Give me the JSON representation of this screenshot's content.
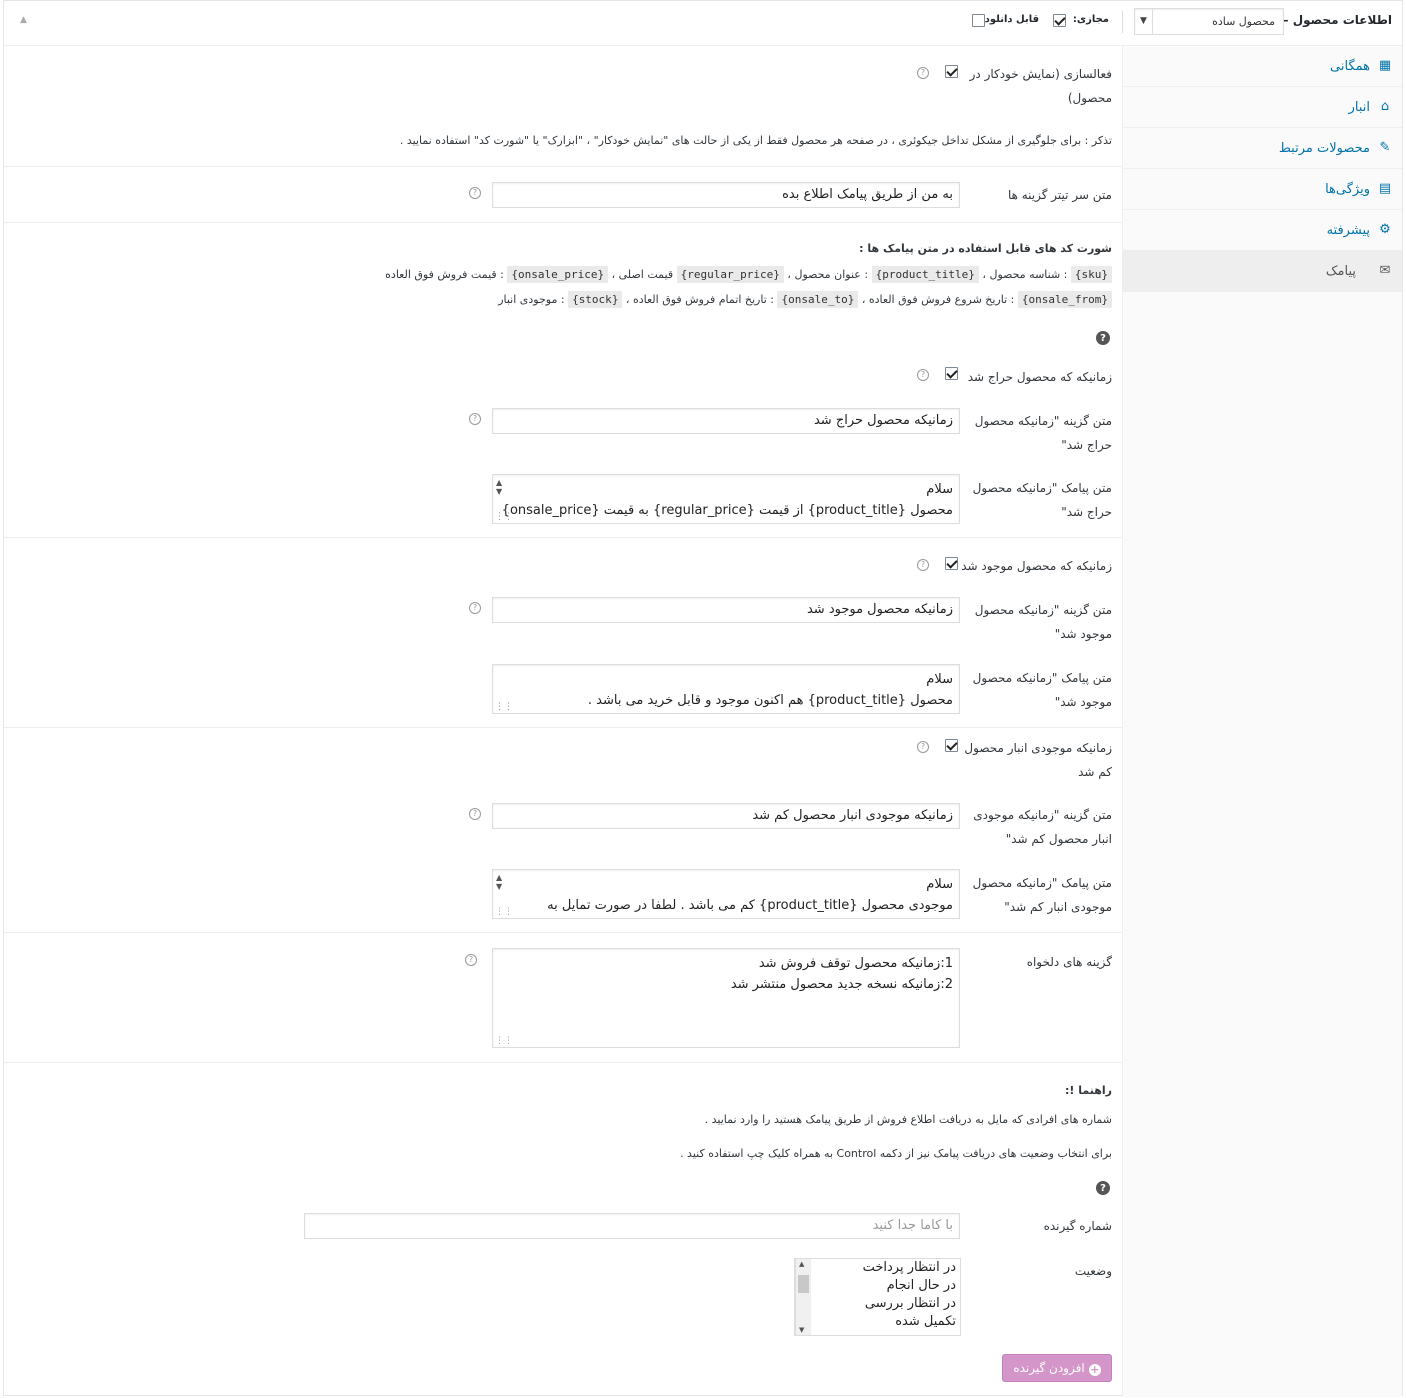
{
  "header": {
    "title": "اطلاعات محصول —",
    "product_type": "محصول ساده",
    "virtual_label": "مجازی:",
    "downloadable_label": "قابل دانلود:",
    "virtual_checked": true,
    "downloadable_checked": false
  },
  "tabs": [
    {
      "label": "همگانی",
      "icon": "general-icon"
    },
    {
      "label": "انبار",
      "icon": "inventory-icon"
    },
    {
      "label": "محصولات مرتبط",
      "icon": "link-icon"
    },
    {
      "label": "ویژگی‌ها",
      "icon": "attributes-icon"
    },
    {
      "label": "پیشرفته",
      "icon": "gear-icon"
    },
    {
      "label": "پیامک",
      "icon": "mail-icon",
      "active": true
    }
  ],
  "auto_display": {
    "label_line1": "فعالسازی (نمایش خودکار در",
    "label_line2": "محصول)",
    "checked": true,
    "note": "تذکر : برای جلوگیری از مشکل تداخل جیکوئری ، در صفحه هر محصول فقط از یکی از حالت های \"نمایش خودکار\" ، \"ابزارک\" یا \"شورت کد\" استفاده نمایید ."
  },
  "header_text": {
    "label": "متن سر تیتر گزینه ها",
    "value": "به من از طریق پیامک اطلاع بده"
  },
  "shortcodes": {
    "title": "شورت کد های قابل استفاده در متن پیامک ها :",
    "line1": [
      {
        "code": "{sku}",
        "desc": " : شناسه محصول ، "
      },
      {
        "code": "{product_title}",
        "desc": " : عنوان محصول ، "
      },
      {
        "code": "{regular_price}",
        "desc": " قیمت اصلی ، "
      },
      {
        "code": "{onsale_price}",
        "desc": " : قیمت فروش فوق العاده"
      }
    ],
    "line2": [
      {
        "code": "{onsale_from}",
        "desc": " : تاریخ شروع فروش فوق العاده ، "
      },
      {
        "code": "{onsale_to}",
        "desc": " : تاریخ اتمام فروش فوق العاده ، "
      },
      {
        "code": "{stock}",
        "desc": " : موجودی انبار"
      }
    ]
  },
  "onsale": {
    "toggle_label": "زمانیکه که محصول حراج شد",
    "checked": true,
    "option_label_1": "متن گزینه \"زمانیکه محصول",
    "option_label_2": "حراج شد\"",
    "option_value": "زمانیکه محصول حراج شد",
    "sms_label_1": "متن پیامک \"زمانیکه محصول",
    "sms_label_2": "حراج شد\"",
    "sms_line1": "سلام",
    "sms_line2": "محصول {product_title} از قیمت {regular_price} به قیمت {onsale_price}"
  },
  "instock": {
    "toggle_label": "زمانیکه که محصول موجود شد",
    "checked": true,
    "option_label_1": "متن گزینه \"زمانیکه محصول",
    "option_label_2": "موجود شد\"",
    "option_value": "زمانیکه محصول موجود شد",
    "sms_label_1": "متن پیامک \"زمانیکه محصول",
    "sms_label_2": "موجود شد\"",
    "sms_line1": "سلام",
    "sms_line2": "محصول {product_title} هم اکنون موجود و قابل خرید می باشد ."
  },
  "lowstock": {
    "toggle_label_1": "زمانیکه موجودی انبار محصول",
    "toggle_label_2": "کم شد",
    "checked": true,
    "option_label_1": "متن گزینه \"زمانیکه موجودی",
    "option_label_2": "انبار محصول کم شد\"",
    "option_value": "زمانیکه موجودی انبار محصول کم شد",
    "sms_label_1": "متن پیامک \"زمانیکه محصول",
    "sms_label_2": "موجودی انبار کم شد\"",
    "sms_line1": "سلام",
    "sms_line2": "موجودی محصول {product_title} کم می باشد . لطفا در صورت تمایل به"
  },
  "custom_options": {
    "label": "گزینه های دلخواه",
    "line1": "1:زمانیکه محصول توقف فروش شد",
    "line2": "2:زمانیکه نسخه جدید محصول منتشر شد"
  },
  "guide": {
    "title": "راهنما !:",
    "line1": "شماره های افرادی که مایل به دریافت اطلاع فروش از طریق پیامک هستید را وارد نمایید .",
    "line2": "برای انتخاب وضعیت های دریافت پیامک نیز از دکمه Control به همراه کلیک چپ استفاده کنید ."
  },
  "recipient": {
    "label": "شماره گیرنده",
    "placeholder": "با کاما جدا کنید"
  },
  "status": {
    "label": "وضعیت",
    "options": [
      "در انتظار پرداخت",
      "در حال انجام",
      "در انتظار بررسی",
      "تکمیل شده"
    ]
  },
  "add_button": "افزودن گیرنده"
}
